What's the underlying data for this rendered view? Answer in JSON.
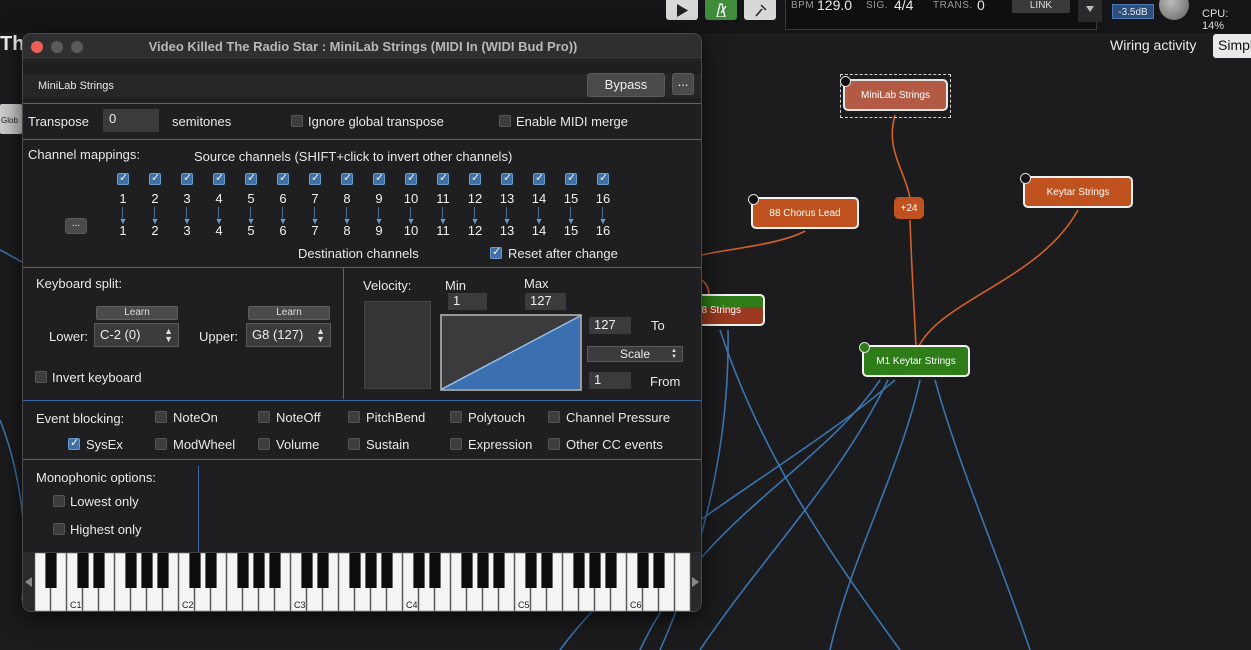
{
  "topbar": {
    "bpm_label": "BPM",
    "bpm": "129.0",
    "sig_label": "SIG.",
    "sig": "4/4",
    "trans_label": "TRANS.",
    "trans": "0",
    "link": "LINK",
    "volume": "-3.5dB",
    "cpu": "CPU:  14%"
  },
  "canvas": {
    "title": "The",
    "wiring_label": "Wiring activity",
    "view_mode": "Simpl",
    "glob": "Glob",
    "nodes": {
      "minilab": "MiniLab Strings",
      "chorus": "88 Chorus Lead",
      "keytar": "Keytar Strings",
      "m1": "M1 Keytar Strings",
      "strings88": "8 Strings",
      "transpose_badge": "+24"
    }
  },
  "window": {
    "title": "Video Killed The Radio Star : MiniLab Strings (MIDI In (WIDI Bud Pro))",
    "name": "MiniLab Strings",
    "bypass": "Bypass",
    "more": "...",
    "transpose_label": "Transpose",
    "transpose_value": "0",
    "semitones": "semitones",
    "ignore_global": "Ignore global transpose",
    "enable_merge": "Enable MIDI merge",
    "channel_mappings": "Channel mappings:",
    "source_channels": "Source channels (SHIFT+click to invert other channels)",
    "channels": [
      "1",
      "2",
      "3",
      "4",
      "5",
      "6",
      "7",
      "8",
      "9",
      "10",
      "11",
      "12",
      "13",
      "14",
      "15",
      "16"
    ],
    "dest_more": "...",
    "dest_channels": "Destination channels",
    "reset_after": "Reset after change",
    "keyboard_split": "Keyboard split:",
    "learn": "Learn",
    "lower_label": "Lower:",
    "lower_value": "C-2 (0)",
    "upper_label": "Upper:",
    "upper_value": "G8 (127)",
    "invert_keyboard": "Invert keyboard",
    "velocity_label": "Velocity:",
    "min_label": "Min",
    "min_value": "1",
    "max_label": "Max",
    "max_value": "127",
    "to_value": "127",
    "to_label": "To",
    "scale": "Scale",
    "from_value": "1",
    "from_label": "From",
    "event_blocking": "Event blocking:",
    "events_row1": [
      "NoteOn",
      "NoteOff",
      "PitchBend",
      "Polytouch",
      "Channel Pressure"
    ],
    "events_row2": [
      "SysEx",
      "ModWheel",
      "Volume",
      "Sustain",
      "Expression",
      "Other CC events"
    ],
    "monophonic": "Monophonic options:",
    "lowest_only": "Lowest only",
    "highest_only": "Highest only",
    "octaves": [
      "C1",
      "C2",
      "C3",
      "C4",
      "C5",
      "C6"
    ]
  },
  "colors": {
    "accent_blue": "#3c6aa8",
    "node_red": "#c0521f",
    "node_green": "#2f7d18",
    "node_selected": "#b35a45"
  }
}
